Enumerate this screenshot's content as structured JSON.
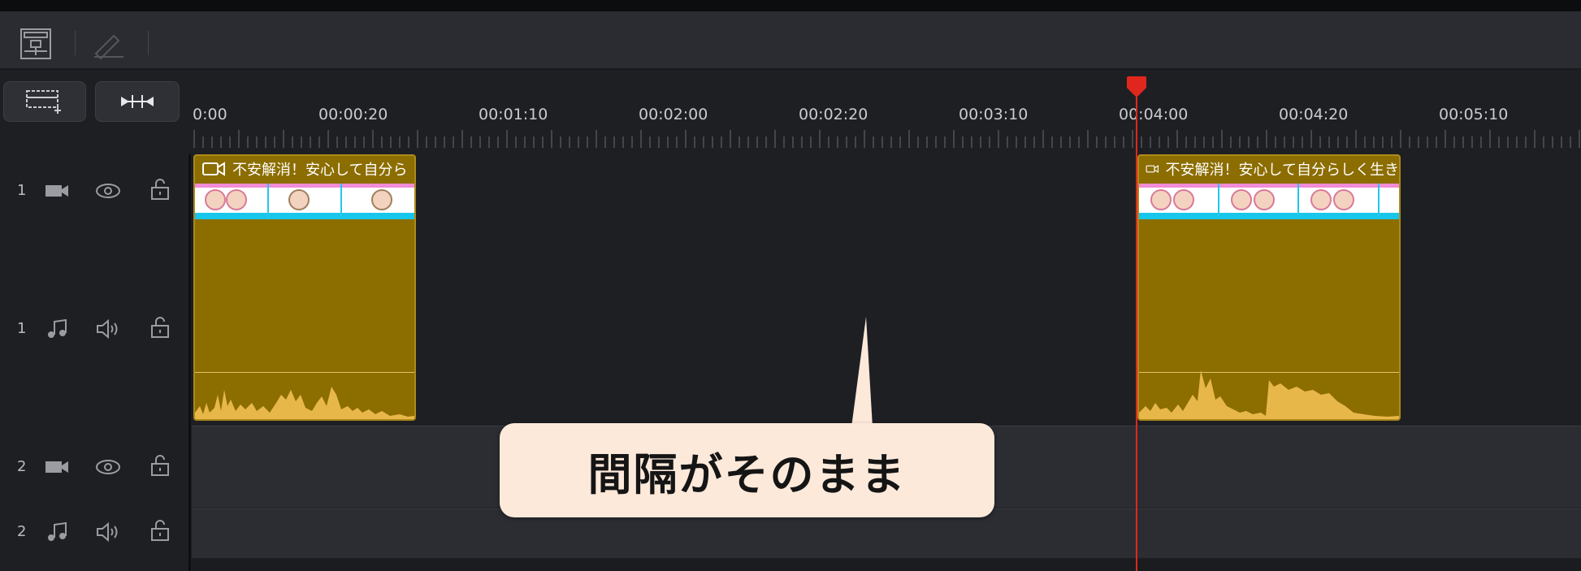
{
  "toolbar": {
    "icons": [
      "layout-icon",
      "pen-icon"
    ]
  },
  "left_panel": {
    "buttons": [
      "add-track-icon",
      "split-gap-icon"
    ],
    "tracks": [
      {
        "num": "1",
        "type": "video",
        "icons": [
          "camera-icon",
          "eye-icon",
          "lock-icon"
        ]
      },
      {
        "num": "1",
        "type": "audio",
        "icons": [
          "music-note-icon",
          "speaker-icon",
          "lock-icon"
        ]
      },
      {
        "num": "2",
        "type": "video",
        "icons": [
          "camera-icon",
          "eye-icon",
          "lock-icon"
        ]
      },
      {
        "num": "2",
        "type": "audio",
        "icons": [
          "music-note-icon",
          "speaker-icon",
          "lock-icon"
        ]
      }
    ]
  },
  "ruler": {
    "labels": [
      "0:00",
      "00:00:20",
      "00:01:10",
      "00:02:00",
      "00:02:20",
      "00:03:10",
      "00:04:00",
      "00:04:20",
      "00:05:10"
    ]
  },
  "clips": [
    {
      "title": "不安解消！安心して自分ら"
    },
    {
      "title": "不安解消！安心して自分らしく生き"
    }
  ],
  "callout": {
    "text": "間隔がそのまま"
  },
  "colors": {
    "clip": "#8c6d00",
    "waveform": "#e8b74a",
    "playhead": "#e0271d",
    "callout_bg": "#fde9da"
  }
}
